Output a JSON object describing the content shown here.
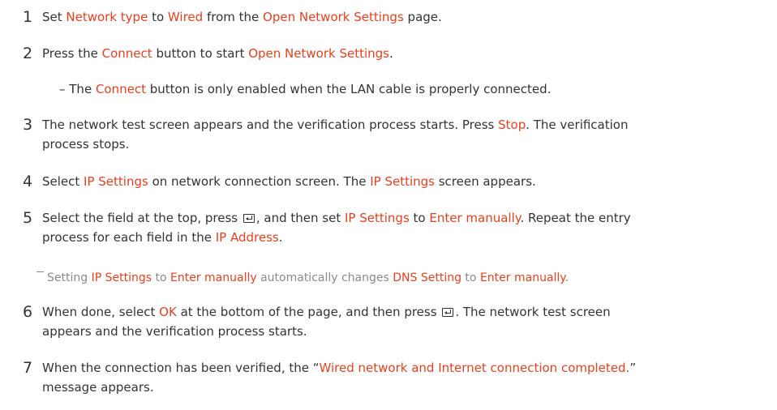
{
  "steps": [
    {
      "num": "1",
      "line1": [
        {
          "t": "Set ",
          "h": false
        },
        {
          "t": "Network type",
          "h": true
        },
        {
          "t": " to ",
          "h": false
        },
        {
          "t": "Wired",
          "h": true
        },
        {
          "t": " from the ",
          "h": false
        },
        {
          "t": "Open Network Settings",
          "h": true
        },
        {
          "t": " page.",
          "h": false
        }
      ]
    },
    {
      "num": "2",
      "line1": [
        {
          "t": "Press the ",
          "h": false
        },
        {
          "t": "Connect",
          "h": true
        },
        {
          "t": " button to start ",
          "h": false
        },
        {
          "t": "Open Network Settings",
          "h": true
        },
        {
          "t": ".",
          "h": false
        }
      ],
      "sub": [
        {
          "t": "– The ",
          "h": false
        },
        {
          "t": "Connect",
          "h": true
        },
        {
          "t": " button is only enabled when the LAN cable is properly connected.",
          "h": false
        }
      ]
    },
    {
      "num": "3",
      "line1": [
        {
          "t": "The network test screen appears and the verification process starts. Press ",
          "h": false
        },
        {
          "t": "Stop",
          "h": true
        },
        {
          "t": ". The verification",
          "h": false
        }
      ],
      "line2": [
        {
          "t": "process stops.",
          "h": false
        }
      ]
    },
    {
      "num": "4",
      "line1": [
        {
          "t": "Select ",
          "h": false
        },
        {
          "t": "IP Settings",
          "h": true
        },
        {
          "t": " on network connection screen. The ",
          "h": false
        },
        {
          "t": "IP Settings",
          "h": true
        },
        {
          "t": " screen appears.",
          "h": false
        }
      ]
    },
    {
      "num": "5",
      "line1_a": [
        {
          "t": "Select the field at the top, press ",
          "h": false
        }
      ],
      "line1_b": [
        {
          "t": ", and then set ",
          "h": false
        },
        {
          "t": "IP Settings",
          "h": true
        },
        {
          "t": " to ",
          "h": false
        },
        {
          "t": "Enter manually",
          "h": true
        },
        {
          "t": ". Repeat the entry",
          "h": false
        }
      ],
      "line2": [
        {
          "t": "process for each field in the ",
          "h": false
        },
        {
          "t": "IP Address",
          "h": true
        },
        {
          "t": ".",
          "h": false
        }
      ]
    },
    {
      "note": [
        {
          "t": "Setting ",
          "h": false
        },
        {
          "t": "IP Settings",
          "h": true
        },
        {
          "t": " to ",
          "h": false
        },
        {
          "t": "Enter manually",
          "h": true
        },
        {
          "t": " automatically changes ",
          "h": false
        },
        {
          "t": "DNS Setting",
          "h": true
        },
        {
          "t": " to ",
          "h": false
        },
        {
          "t": "Enter manually",
          "h": true
        },
        {
          "t": ".",
          "h": false
        }
      ]
    },
    {
      "num": "6",
      "line1_a": [
        {
          "t": "When done, select ",
          "h": false
        },
        {
          "t": "OK",
          "h": true
        },
        {
          "t": " at the bottom of the page, and then press ",
          "h": false
        }
      ],
      "line1_b": [
        {
          "t": ". The network test screen",
          "h": false
        }
      ],
      "line2": [
        {
          "t": "appears and the verification process starts.",
          "h": false
        }
      ]
    },
    {
      "num": "7",
      "line1": [
        {
          "t": "When the connection has been verified, the “",
          "h": false
        },
        {
          "t": "Wired network and Internet connection completed.",
          "h": true
        },
        {
          "t": "”",
          "h": false
        }
      ],
      "line2": [
        {
          "t": "message appears.",
          "h": false
        }
      ]
    }
  ],
  "icons": {
    "enter": "enter-key-icon"
  },
  "colors": {
    "highlight": "#e8401c",
    "text": "#333333",
    "note": "#8a8a8a"
  }
}
